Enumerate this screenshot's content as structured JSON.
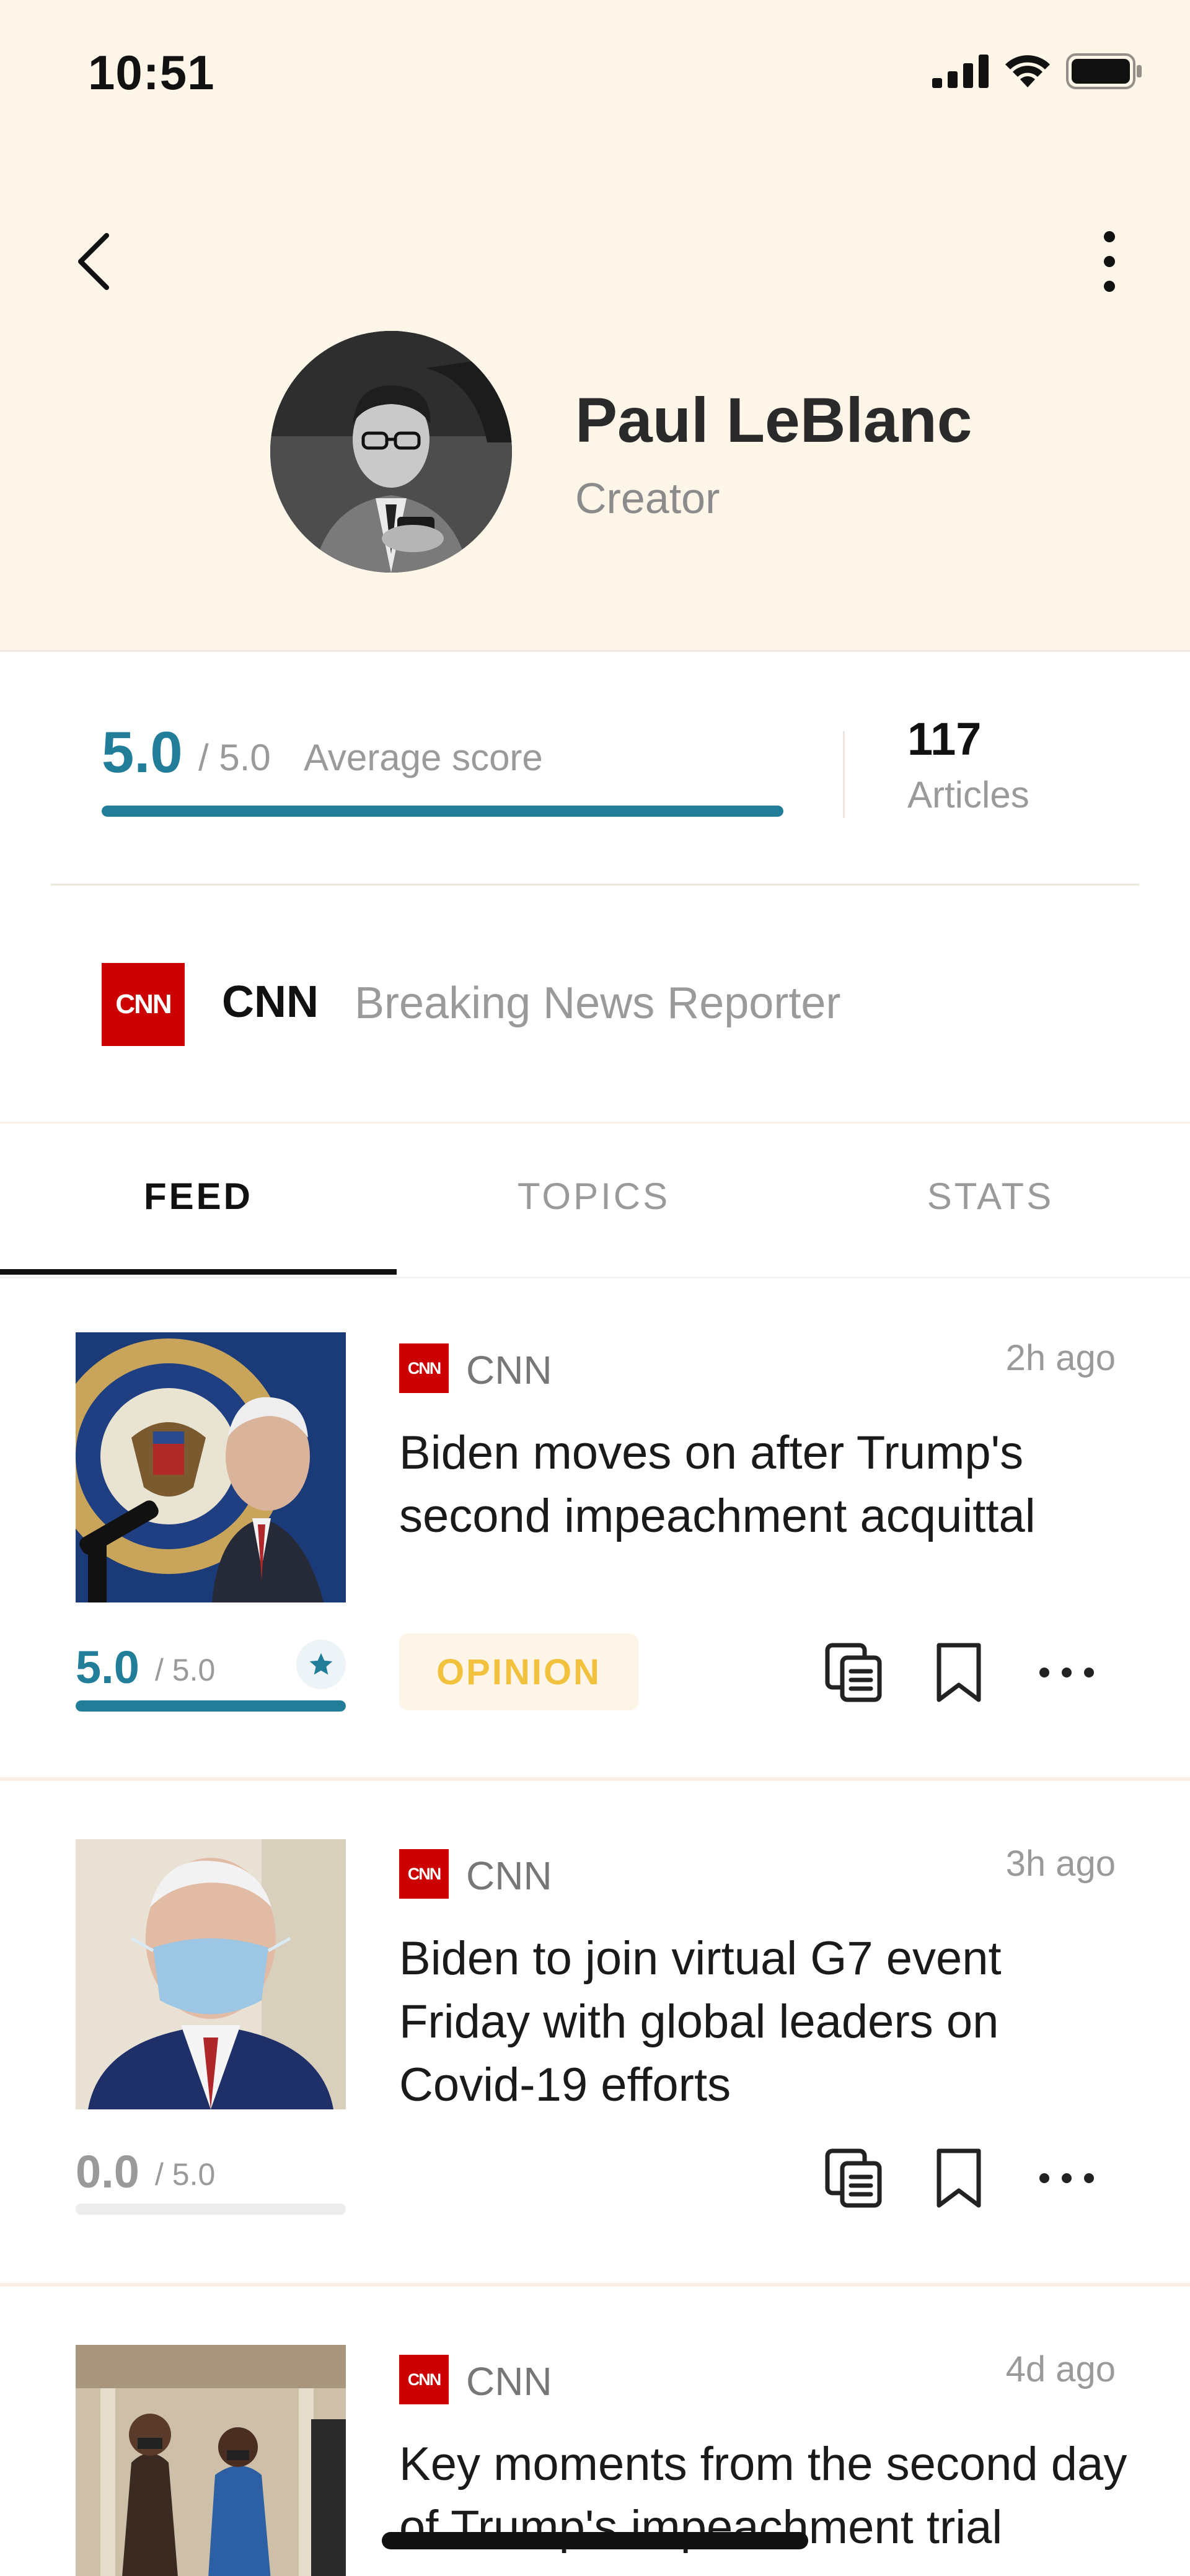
{
  "status_bar": {
    "time": "10:51"
  },
  "profile": {
    "name": "Paul LeBlanc",
    "role": "Creator"
  },
  "stats": {
    "average_score": "5.0",
    "score_max": "/ 5.0",
    "score_label": "Average score",
    "score_fraction": 1.0,
    "articles_count": "117",
    "articles_label": "Articles"
  },
  "affiliation": {
    "logo_text": "CNN",
    "outlet": "CNN",
    "role": "Breaking News Reporter"
  },
  "tabs": [
    {
      "label": "FEED",
      "active": true
    },
    {
      "label": "TOPICS",
      "active": false
    },
    {
      "label": "STATS",
      "active": false
    }
  ],
  "feed": [
    {
      "logo_text": "CNN",
      "outlet": "CNN",
      "time": "2h ago",
      "title": "Biden moves on after Trump's second impeachment acquittal",
      "score": "5.0",
      "score_max": "/ 5.0",
      "score_fraction": 1.0,
      "badge": "OPINION",
      "starred": true
    },
    {
      "logo_text": "CNN",
      "outlet": "CNN",
      "time": "3h ago",
      "title": "Biden to join virtual G7 event Friday with global leaders on Covid-19 efforts",
      "score": "0.0",
      "score_max": "/ 5.0",
      "score_fraction": 0.0,
      "badge": "",
      "starred": false
    },
    {
      "logo_text": "CNN",
      "outlet": "CNN",
      "time": "4d ago",
      "title": "Key moments from the second day of Trump's impeachment trial"
    }
  ],
  "colors": {
    "header_bg": "#fdf5e8",
    "accent": "#227d99",
    "cnn_red": "#cc0000",
    "opinion": "#f2c23e"
  },
  "icons": [
    "back-chevron-icon",
    "more-vertical-icon",
    "cellular-signal-icon",
    "wifi-icon",
    "battery-icon",
    "star-icon",
    "copy-icon",
    "bookmark-icon",
    "more-horizontal-icon"
  ]
}
